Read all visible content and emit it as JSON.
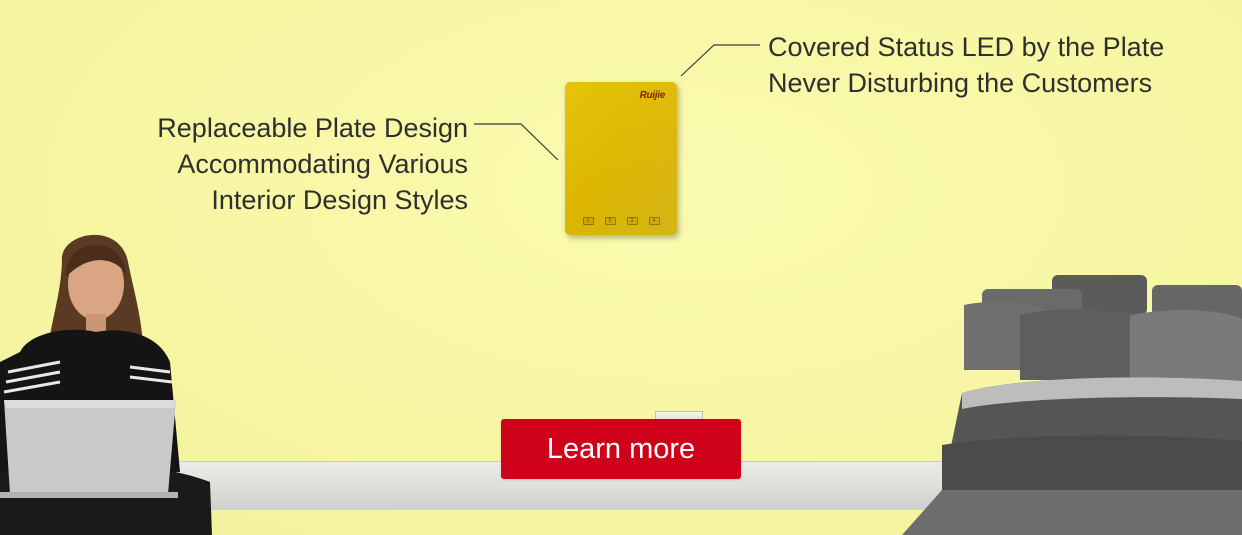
{
  "callouts": {
    "left": {
      "line1": "Replaceable Plate Design",
      "line2": "Accommodating Various",
      "line3": "Interior Design Styles"
    },
    "right": {
      "line1": "Covered Status LED by the Plate",
      "line2": "Never Disturbing the Customers"
    }
  },
  "device": {
    "logo": "Ruijie",
    "ports": [
      "1",
      "2",
      "3",
      "4"
    ],
    "color": "#dcb600"
  },
  "cta": {
    "label": "Learn more",
    "color": "#d0021b"
  },
  "background_color": "#f7f6a3"
}
